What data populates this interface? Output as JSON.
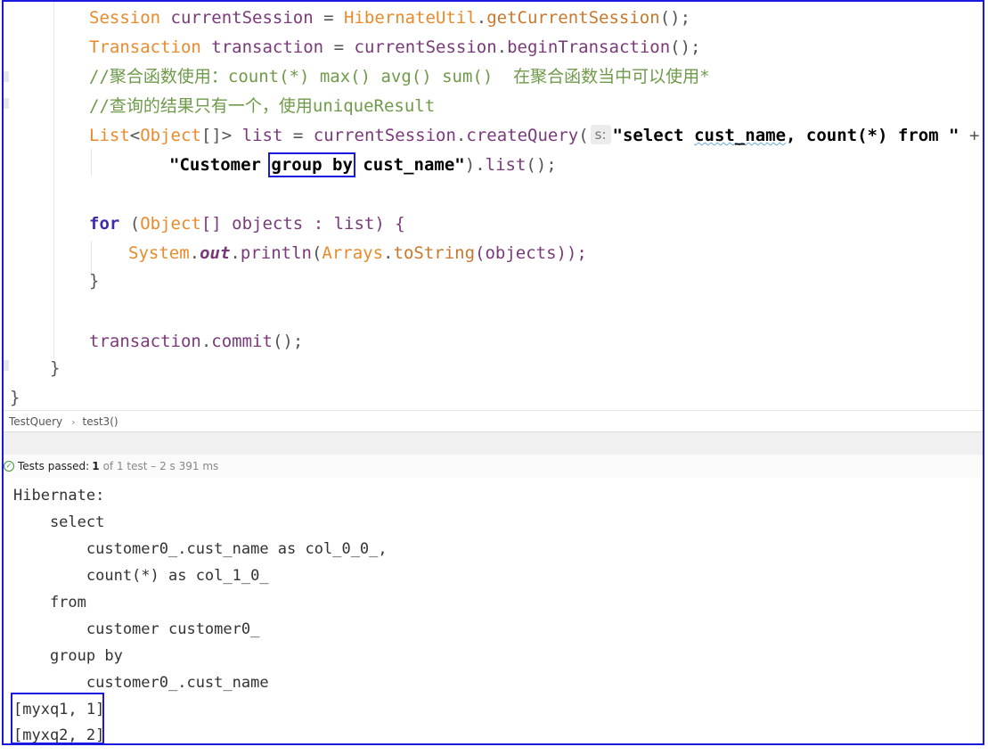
{
  "editor": {
    "lines": {
      "l1": {
        "cls": "Session",
        "var": "currentSession",
        "eq": "=",
        "util": "HibernateUtil",
        "dot": ".",
        "method": "getCurrentSession",
        "end": "();"
      },
      "l2": {
        "cls": "Transaction",
        "var": "transaction",
        "eq": "=",
        "obj": "currentSession",
        "dot": ".",
        "method": "beginTransaction",
        "end": "();"
      },
      "l3": {
        "comment": "//聚合函数使用：count(*) max() avg() sum()  在聚合函数当中可以使用*"
      },
      "l4": {
        "comment": "//查询的结果只有一个，使用uniqueResult"
      },
      "l5": {
        "list_type": "List",
        "lt": "<",
        "obj_type": "Object",
        "gt": "[]>",
        "var": "list",
        "eq": "=",
        "obj": "currentSession",
        "dot": ".",
        "method": "createQuery",
        "open": "(",
        "hint": "s:",
        "string_part1": "\"select ",
        "string_field1": "cust_name",
        "string_part2": ", count(*) from \"",
        "plus": "+"
      },
      "l6": {
        "string_part1": "\"Customer ",
        "string_boxed": "group by",
        "string_part2": " cust_name\"",
        "close": ").",
        "method": "list",
        "end": "();"
      },
      "l7": {
        "kw": "for",
        "open": " (",
        "obj_type": "Object",
        "rest": "[] objects : list) {"
      },
      "l8": {
        "cls": "System",
        "dot1": ".",
        "field": "out",
        "dot2": ".",
        "method": "println",
        "open": "(",
        "arrays": "Arrays",
        "dot3": ".",
        "tostring": "toString",
        "args": "(objects));"
      },
      "l9": {
        "text": "}"
      },
      "l10": {
        "obj": "transaction",
        "dot": ".",
        "method": "commit",
        "end": "();"
      },
      "l11": {
        "text": "}"
      },
      "l12": {
        "text": "}"
      }
    }
  },
  "breadcrumb": {
    "class_name": "TestQuery",
    "separator": "›",
    "method_name": "test3()"
  },
  "status": {
    "icon": "check-circle-icon",
    "label": "Tests passed:",
    "count": "1",
    "detail": "of 1 test – 2 s 391 ms"
  },
  "console": {
    "lines": [
      "Hibernate:",
      "    select",
      "        customer0_.cust_name as col_0_0_,",
      "        count(*) as col_1_0_",
      "    from",
      "        customer customer0_",
      "    group by",
      "        customer0_.cust_name",
      "[myxq1, 1]",
      "[myxq2, 2]"
    ]
  },
  "colors": {
    "highlight_box": "#1a1adf",
    "class_orange": "#e98a2b",
    "keyword": "#3b2bb0",
    "comment": "#6f9a4a"
  }
}
